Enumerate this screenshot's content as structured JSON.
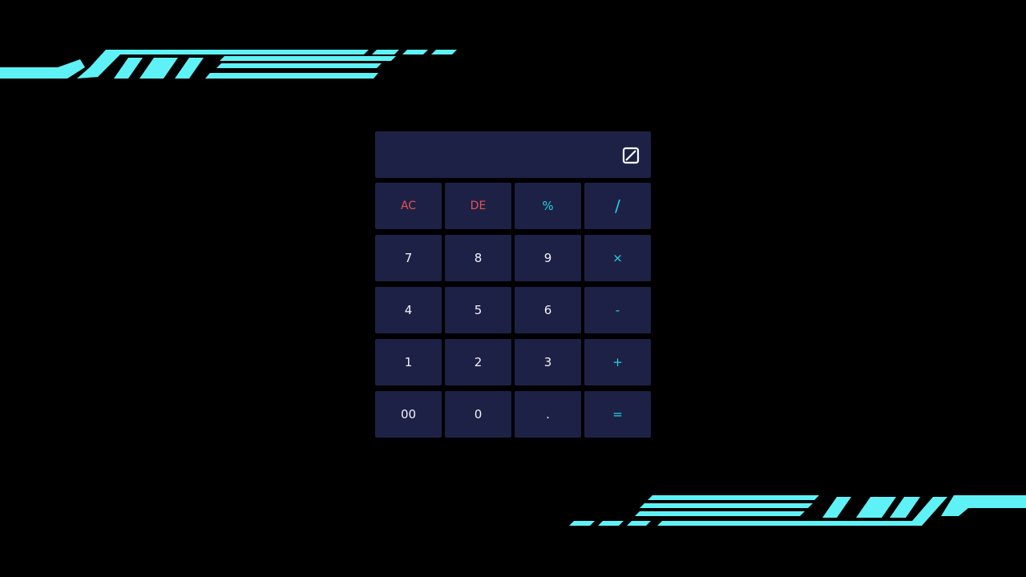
{
  "display": {
    "value": "",
    "toggle_icon": "square-slash-icon"
  },
  "colors": {
    "background": "#000000",
    "panel": "#1e2146",
    "accent_cyan": "#5ef2f6",
    "operator_text": "#22d3e6",
    "clear_text": "#e55252",
    "digit_text": "#f3f3f6"
  },
  "keys": {
    "ac": "AC",
    "de": "DE",
    "percent": "%",
    "divide": "/",
    "seven": "7",
    "eight": "8",
    "nine": "9",
    "multiply": "×",
    "four": "4",
    "five": "5",
    "six": "6",
    "minus": "-",
    "one": "1",
    "two": "2",
    "three": "3",
    "plus": "+",
    "double_zero": "00",
    "zero": "0",
    "dot": ".",
    "equals": "="
  }
}
